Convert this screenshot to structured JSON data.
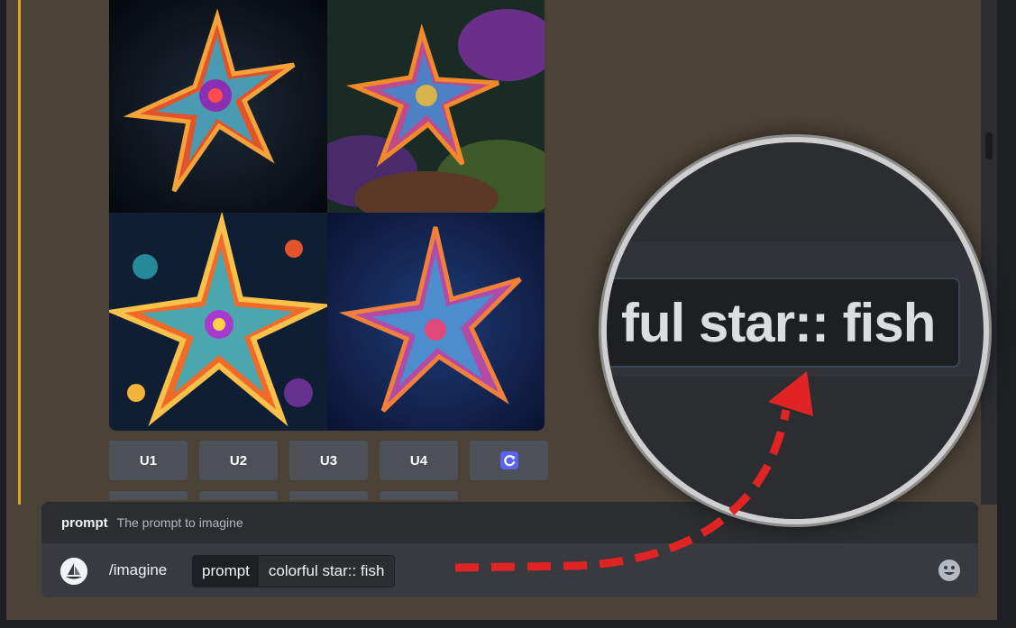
{
  "image_grid": {
    "tiles": [
      "starfish-dark-background",
      "starfish-on-reef",
      "starfish-illustration",
      "starfish-blue-background"
    ]
  },
  "actions": {
    "upscale_buttons": [
      "U1",
      "U2",
      "U3",
      "U4"
    ],
    "reroll_icon": "refresh-icon",
    "accent_color": "#5865f2"
  },
  "slash_command": {
    "hint_option": "prompt",
    "hint_description": "The prompt to imagine",
    "command": "/imagine",
    "option_name": "prompt",
    "option_value": "colorful star:: fish",
    "emoji_icon": "smiley-icon"
  },
  "magnifier": {
    "zoomed_text": "ful star:: fish"
  },
  "annotation": {
    "arrow_color": "#e02424"
  }
}
